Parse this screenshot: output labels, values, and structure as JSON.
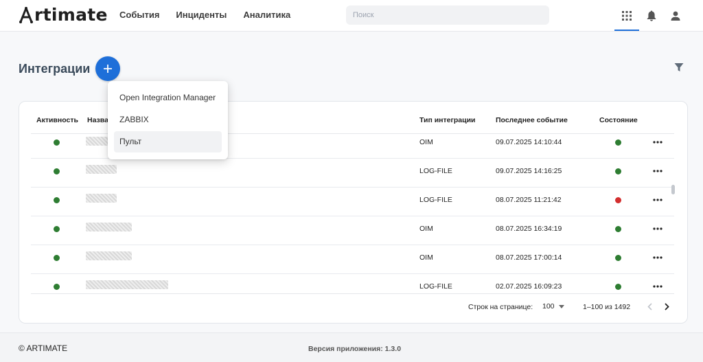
{
  "header": {
    "logo_text": "rtimate",
    "nav": [
      "События",
      "Инциденты",
      "Аналитика"
    ],
    "search_placeholder": "Поиск",
    "accent_color": "#1e6fd9"
  },
  "page": {
    "title": "Интеграции"
  },
  "table": {
    "columns": {
      "activity": "Активность",
      "name": "Название",
      "type": "Тип интеграции",
      "last_event": "Последнее событие",
      "state": "Состояние"
    },
    "rows": [
      {
        "activity": "green",
        "type": "OIM",
        "last_event": "09.07.2025 14:10:44",
        "state": "green"
      },
      {
        "activity": "green",
        "type": "LOG-FILE",
        "last_event": "09.07.2025 14:16:25",
        "state": "green"
      },
      {
        "activity": "green",
        "type": "LOG-FILE",
        "last_event": "08.07.2025 11:21:42",
        "state": "red"
      },
      {
        "activity": "green",
        "type": "OIM",
        "last_event": "08.07.2025 16:34:19",
        "state": "green"
      },
      {
        "activity": "green",
        "type": "OIM",
        "last_event": "08.07.2025 17:00:14",
        "state": "green"
      },
      {
        "activity": "green",
        "type": "LOG-FILE",
        "last_event": "02.07.2025 16:09:23",
        "state": "green"
      }
    ],
    "status_colors": {
      "green": "#2e7d32",
      "red": "#d32f2f"
    }
  },
  "pagination": {
    "rows_per_page_label": "Строк на странице:",
    "rows_per_page": "100",
    "range": "1–100 из 1492"
  },
  "menu": {
    "items": [
      "Open Integration Manager",
      "ZABBIX",
      "Пульт"
    ],
    "active_index": 2
  },
  "footer": {
    "copyright": "© ARTIMATE",
    "version": "Версия приложения: 1.3.0"
  }
}
